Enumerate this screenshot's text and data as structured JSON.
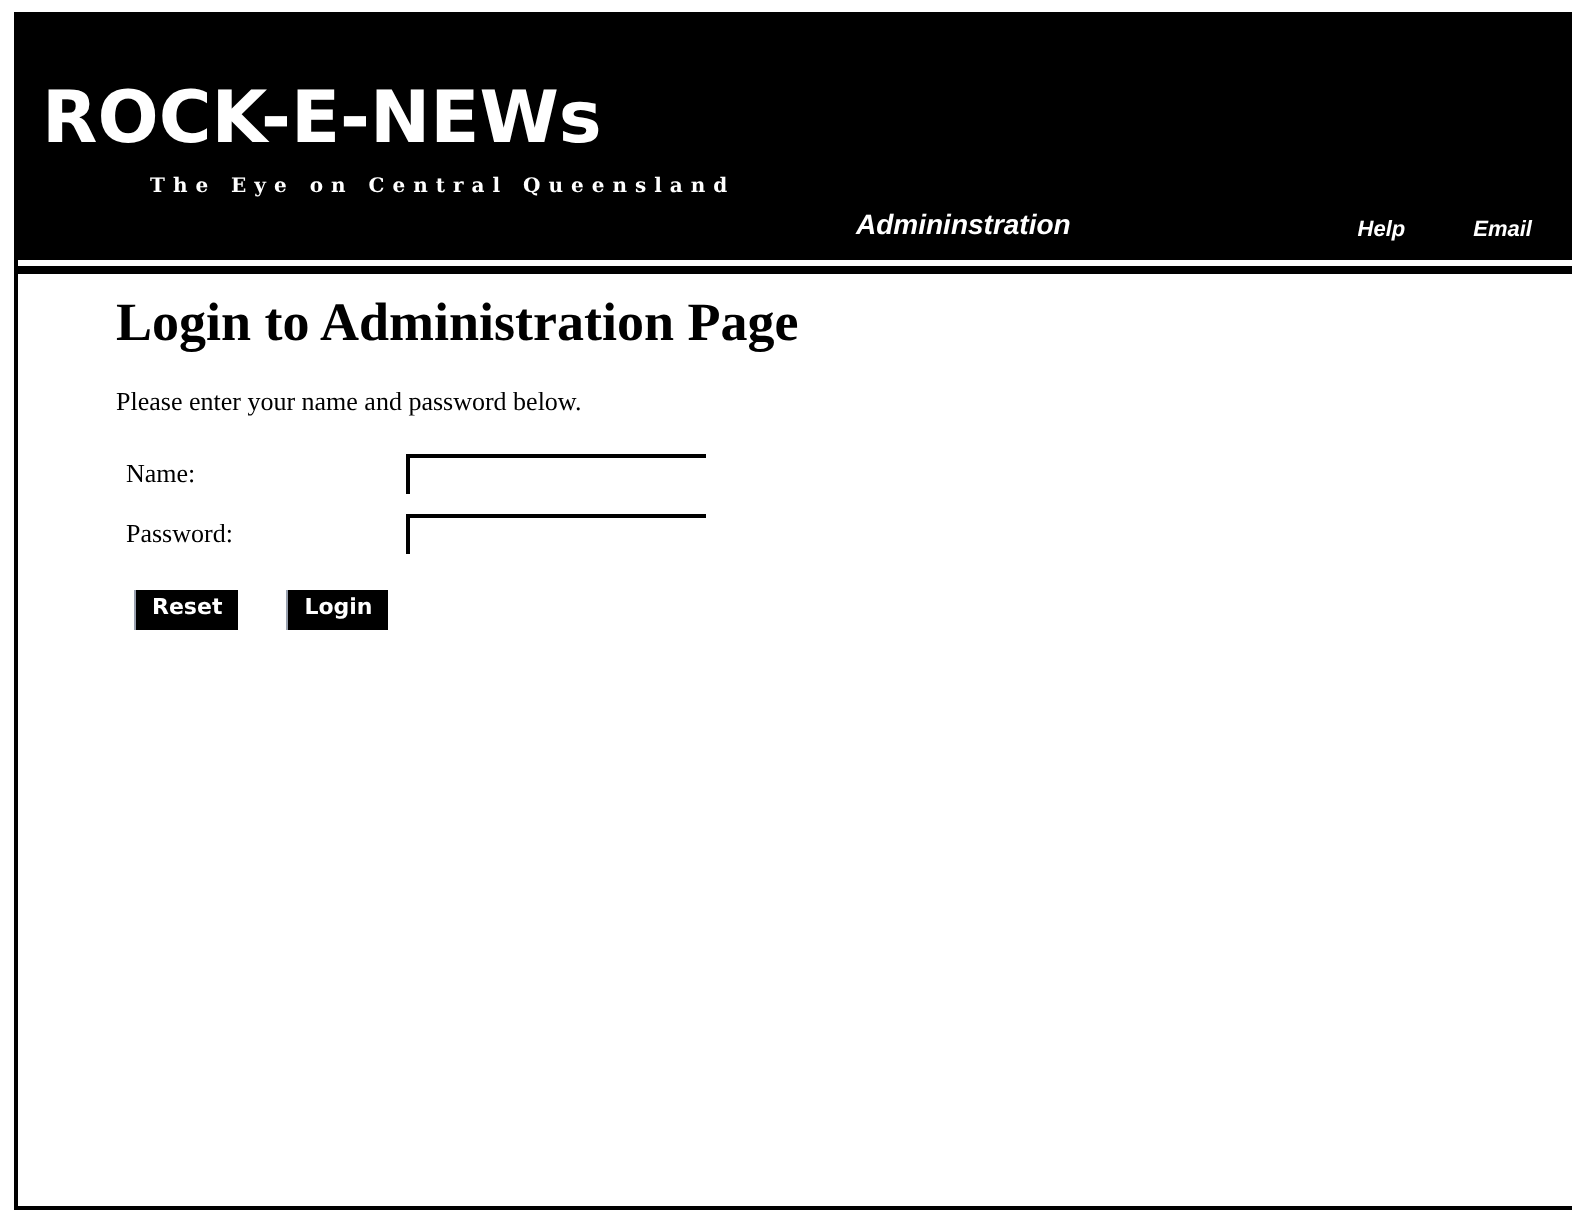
{
  "header": {
    "logo": "ROCK-E-NEWs",
    "tagline": "The Eye on Central Queensland",
    "section": "Admininstration",
    "links": [
      "Help",
      "Email"
    ]
  },
  "page": {
    "title": "Login to Administration Page",
    "intro": "Please enter your name and password below.",
    "fields": [
      {
        "label": "Name:"
      },
      {
        "label": "Password:"
      }
    ],
    "buttons": [
      "Reset",
      "Login"
    ]
  }
}
